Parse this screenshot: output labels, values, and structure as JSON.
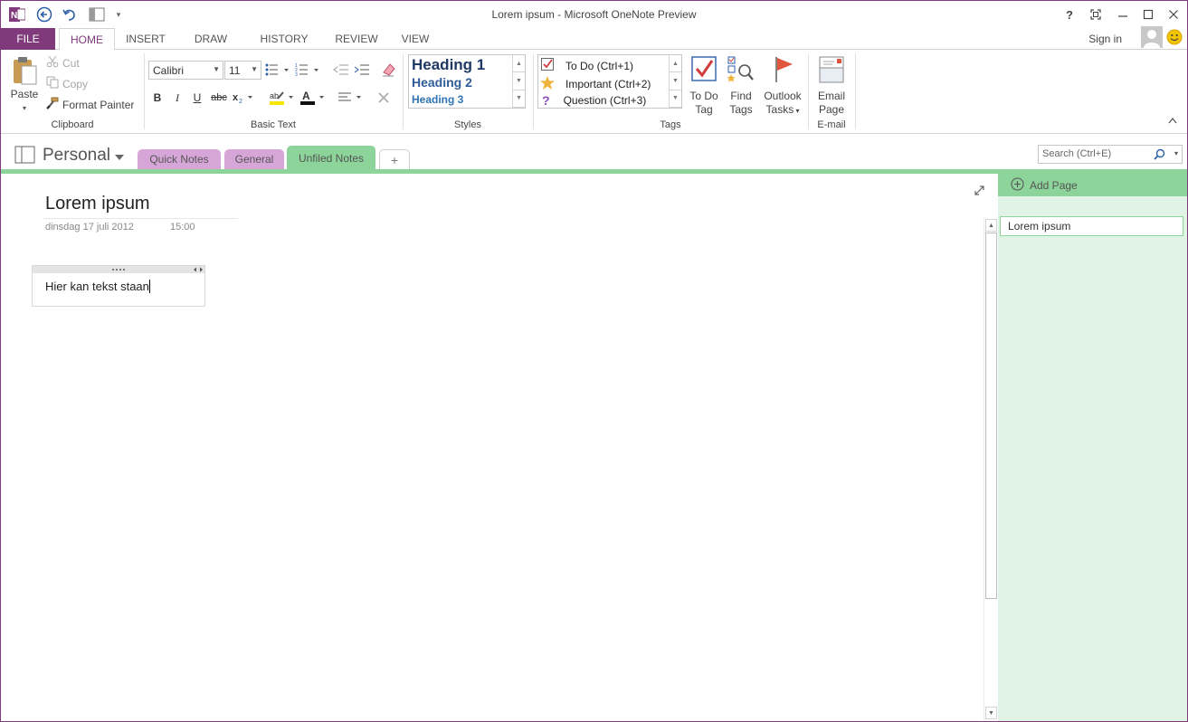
{
  "window": {
    "title": "Lorem ipsum - Microsoft OneNote Preview",
    "help": "?",
    "sign_in": "Sign in"
  },
  "tabs": {
    "file": "FILE",
    "items": [
      "HOME",
      "INSERT",
      "DRAW",
      "HISTORY",
      "REVIEW",
      "VIEW"
    ],
    "active": "HOME"
  },
  "ribbon": {
    "clipboard": {
      "paste": "Paste",
      "cut": "Cut",
      "copy": "Copy",
      "format_painter": "Format Painter",
      "label": "Clipboard"
    },
    "basic_text": {
      "font": "Calibri",
      "size": "11",
      "label": "Basic Text"
    },
    "styles": {
      "items": [
        "Heading 1",
        "Heading 2",
        "Heading 3"
      ],
      "label": "Styles"
    },
    "tags": {
      "items": [
        "To Do (Ctrl+1)",
        "Important (Ctrl+2)",
        "Question (Ctrl+3)"
      ],
      "todo_tag": [
        "To Do",
        "Tag"
      ],
      "find_tags": [
        "Find",
        "Tags"
      ],
      "outlook_tasks": [
        "Outlook",
        "Tasks"
      ],
      "label": "Tags"
    },
    "email": {
      "email_page": [
        "Email",
        "Page"
      ],
      "label": "E-mail"
    }
  },
  "notebook": {
    "name": "Personal",
    "sections": [
      "Quick Notes",
      "General",
      "Unfiled Notes"
    ],
    "active_section": "Unfiled Notes",
    "add_section": "+",
    "search_placeholder": "Search (Ctrl+E)"
  },
  "page": {
    "title": "Lorem ipsum",
    "date": "dinsdag 17 juli 2012",
    "time": "15:00",
    "note_text": "Hier kan tekst staan"
  },
  "page_list": {
    "add_page": "Add Page",
    "pages": [
      "Lorem ipsum"
    ]
  },
  "colors": {
    "brand": "#80397B",
    "section_green": "#8CD49A",
    "section_pink": "#D7A6D9",
    "pane_bg": "#E1F3E4"
  }
}
